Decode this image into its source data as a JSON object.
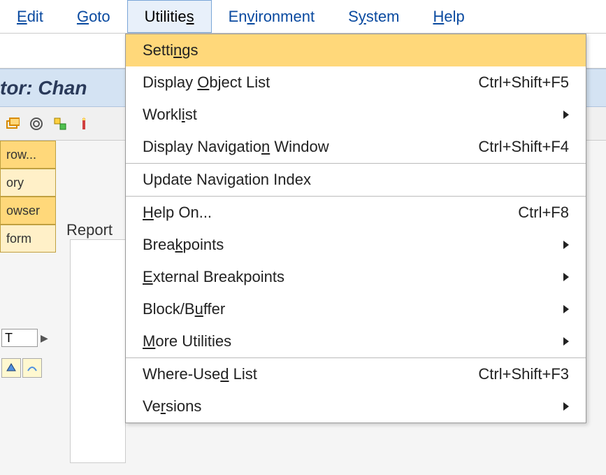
{
  "menubar": {
    "items": [
      {
        "pre": "",
        "u": "E",
        "post": "dit"
      },
      {
        "pre": "",
        "u": "G",
        "post": "oto"
      },
      {
        "pre": "Utilitie",
        "u": "s",
        "post": ""
      },
      {
        "pre": "En",
        "u": "v",
        "post": "ironment"
      },
      {
        "pre": "S",
        "u": "y",
        "post": "stem"
      },
      {
        "pre": "",
        "u": "H",
        "post": "elp"
      }
    ],
    "active_index": 2
  },
  "titlebar": {
    "text": "tor: Chan"
  },
  "left_tabs": {
    "items": [
      "row...",
      "ory",
      "owser",
      "form"
    ]
  },
  "field": {
    "value": "T"
  },
  "report_label": "Report",
  "dropdown": {
    "items": [
      {
        "pre": "Setti",
        "u": "n",
        "post": "gs",
        "shortcut": "",
        "submenu": false,
        "highlighted": true
      },
      {
        "pre": "Display ",
        "u": "O",
        "post": "bject List",
        "shortcut": "Ctrl+Shift+F5",
        "submenu": false
      },
      {
        "pre": "Workl",
        "u": "i",
        "post": "st",
        "shortcut": "",
        "submenu": true
      },
      {
        "pre": "Display Navigatio",
        "u": "n",
        "post": " Window",
        "shortcut": "Ctrl+Shift+F4",
        "submenu": false
      },
      {
        "separator": true
      },
      {
        "pre": "Update Navi",
        "u": "g",
        "post": "ation Index",
        "shortcut": "",
        "submenu": false
      },
      {
        "separator": true
      },
      {
        "pre": "",
        "u": "H",
        "post": "elp On...",
        "shortcut": "Ctrl+F8",
        "submenu": false
      },
      {
        "pre": "Brea",
        "u": "k",
        "post": "points",
        "shortcut": "",
        "submenu": true
      },
      {
        "pre": "",
        "u": "E",
        "post": "xternal Breakpoints",
        "shortcut": "",
        "submenu": true
      },
      {
        "pre": "Block/B",
        "u": "u",
        "post": "ffer",
        "shortcut": "",
        "submenu": true
      },
      {
        "pre": "",
        "u": "M",
        "post": "ore Utilities",
        "shortcut": "",
        "submenu": true
      },
      {
        "separator": true
      },
      {
        "pre": "Where-Use",
        "u": "d",
        "post": " List",
        "shortcut": "Ctrl+Shift+F3",
        "submenu": false
      },
      {
        "pre": "Ve",
        "u": "r",
        "post": "sions",
        "shortcut": "",
        "submenu": true
      }
    ]
  }
}
